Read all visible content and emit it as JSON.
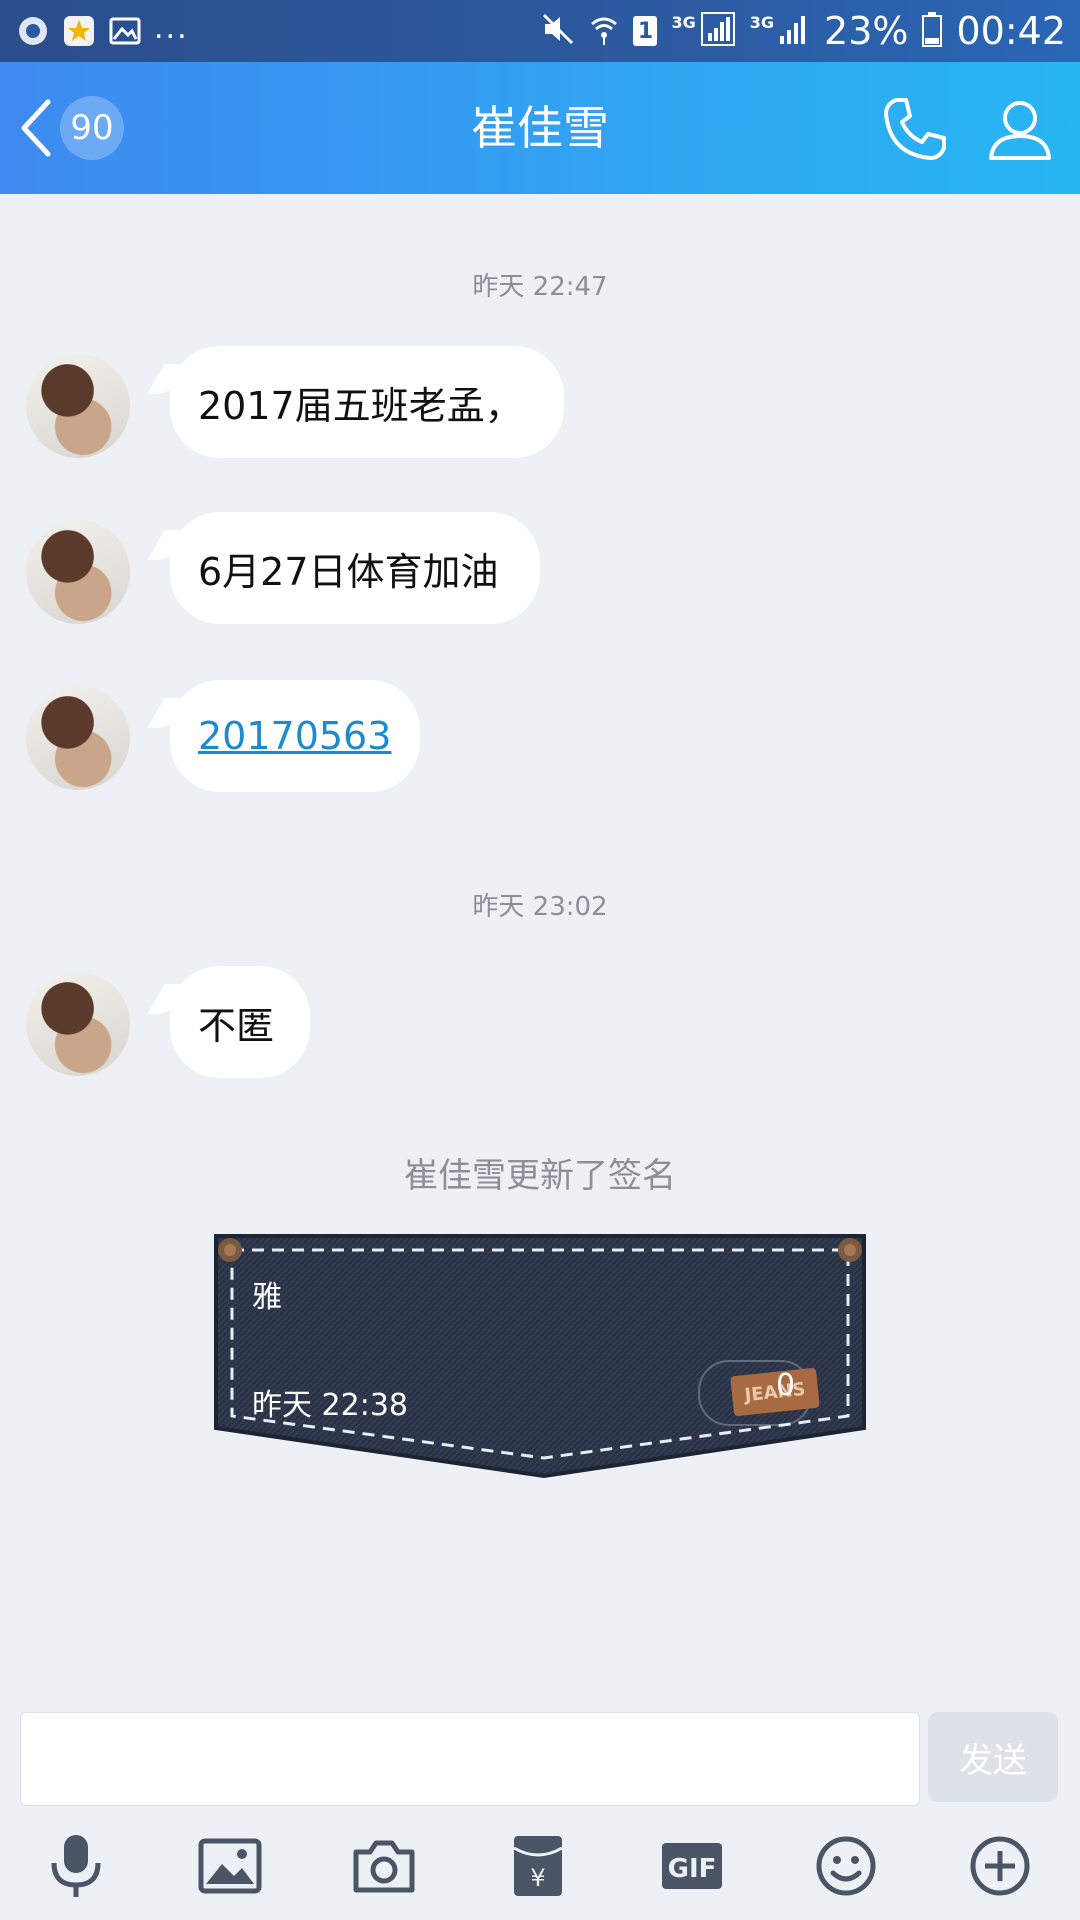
{
  "status_bar": {
    "battery": "23%",
    "time": "00:42",
    "sim_label": "1",
    "net_1": "3G",
    "net_2": "3G",
    "dots": "..."
  },
  "header": {
    "title": "崔佳雪",
    "unread_count": "90"
  },
  "messages": [
    {
      "timestamp": "昨天 22:47"
    },
    {
      "text": "2017届五班老孟，"
    },
    {
      "text": "6月27日体育加油"
    },
    {
      "text": "20170563"
    },
    {
      "timestamp": "昨天 23:02"
    },
    {
      "text": "不匿"
    }
  ],
  "signature_update": {
    "notice": "崔佳雪更新了签名",
    "text": "雅",
    "time": "昨天 22:38",
    "likes": "0",
    "tag_text": "JEANS"
  },
  "input": {
    "placeholder": "",
    "send_label": "发送"
  },
  "toolbar": [
    "mic-icon",
    "image-icon",
    "camera-icon",
    "red-packet-icon",
    "gif-icon",
    "emoji-icon",
    "plus-icon"
  ],
  "colors": {
    "header_start": "#3e8af0",
    "header_end": "#27b6f2",
    "link": "#1c8ad0",
    "background": "#edf1f6"
  }
}
